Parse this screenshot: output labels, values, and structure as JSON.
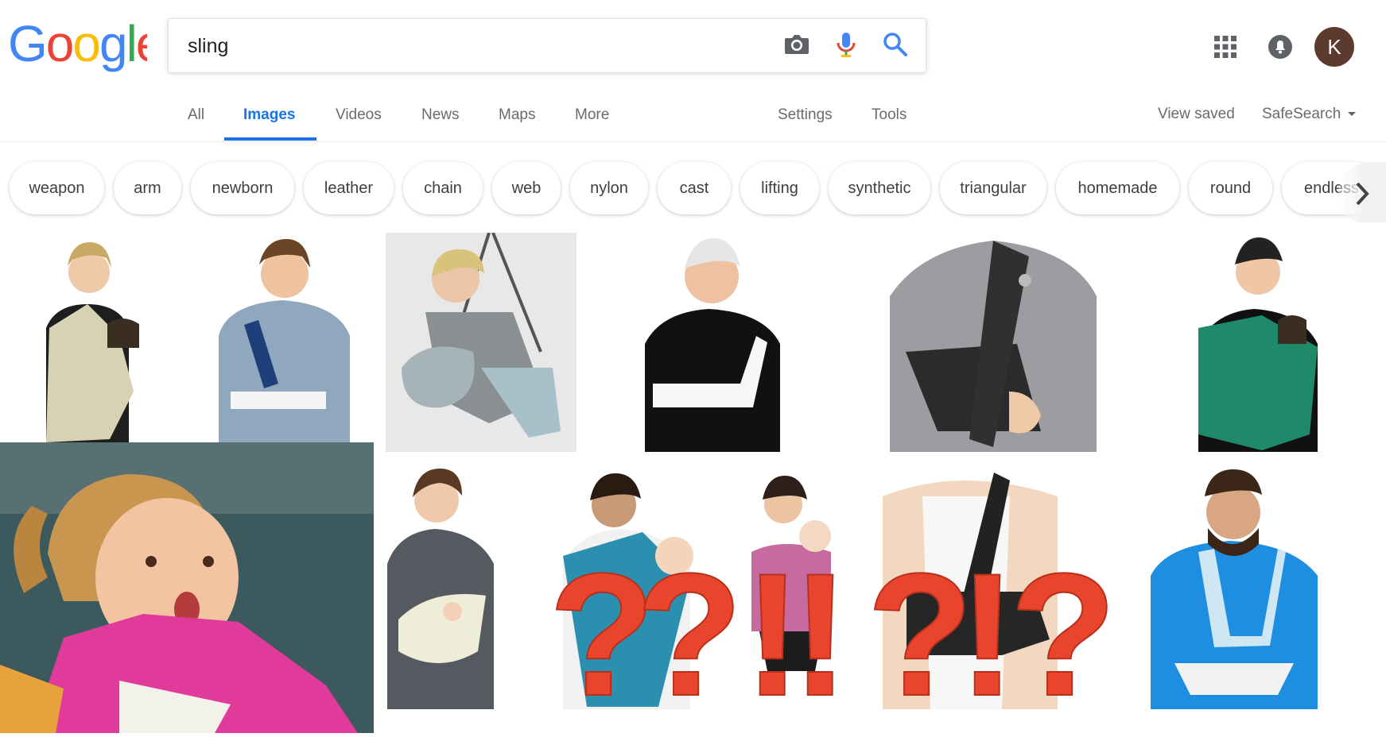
{
  "header": {
    "logo_text": "Google",
    "search_query": "sling",
    "avatar_letter": "K"
  },
  "icons": {
    "camera": "camera-icon",
    "mic": "microphone-icon",
    "search": "search-icon",
    "apps": "apps-grid-icon",
    "notifications": "notifications-icon"
  },
  "tabs": [
    {
      "label": "All"
    },
    {
      "label": "Images",
      "active": true
    },
    {
      "label": "Videos"
    },
    {
      "label": "News"
    },
    {
      "label": "Maps"
    },
    {
      "label": "More"
    },
    {
      "label": "Settings"
    },
    {
      "label": "Tools"
    }
  ],
  "right_links": {
    "view_saved": "View saved",
    "safesearch": "SafeSearch"
  },
  "chips": [
    "weapon",
    "arm",
    "newborn",
    "leather",
    "chain",
    "web",
    "nylon",
    "cast",
    "lifting",
    "synthetic",
    "triangular",
    "homemade",
    "round",
    "endless"
  ],
  "overlay_marks": [
    "?",
    "?",
    "!",
    "!",
    "?",
    "!",
    "?"
  ],
  "colors": {
    "accent": "#1a73e8",
    "overlay_marks": "#e8452c",
    "logo_blue": "#4285f4",
    "logo_red": "#ea4335",
    "logo_yellow": "#fbbc05",
    "logo_green": "#34a853"
  }
}
